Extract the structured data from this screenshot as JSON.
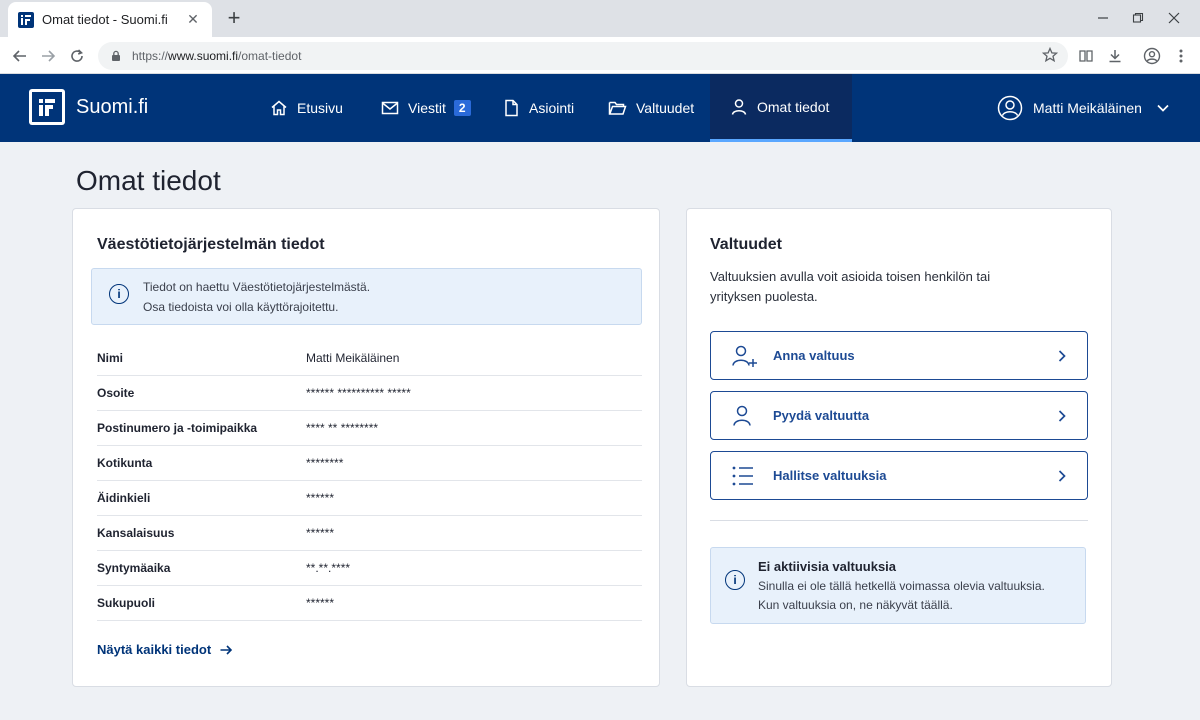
{
  "browser": {
    "tab_title": "Omat tiedot - Suomi.fi",
    "tab_close": "✕",
    "new_tab": "+",
    "url_prefix": "https://",
    "url_host": "www.suomi.fi",
    "url_path": "/omat-tiedot"
  },
  "site": {
    "brand": "Suomi.fi",
    "nav": [
      {
        "label": "Etusivu",
        "icon": "home-icon"
      },
      {
        "label": "Viestit",
        "icon": "mail-icon",
        "badge": "2"
      },
      {
        "label": "Asiointi",
        "icon": "document-icon"
      },
      {
        "label": "Valtuudet",
        "icon": "folder-icon"
      },
      {
        "label": "Omat tiedot",
        "icon": "person-icon",
        "active": true
      }
    ],
    "user_name": "Matti Meikäläinen"
  },
  "page": {
    "title": "Omat tiedot"
  },
  "population_info": {
    "title": "Väestötietojärjestelmän tiedot",
    "info_line1": "Tiedot on haettu Väestötietojärjestelmästä.",
    "info_line2": "Osa tiedoista voi olla käyttörajoitettu.",
    "rows": [
      {
        "label": "Nimi",
        "value": "Matti Meikäläinen"
      },
      {
        "label": "Osoite",
        "value": "****** ********** *****"
      },
      {
        "label": "Postinumero ja -toimipaikka",
        "value": "**** ** ********"
      },
      {
        "label": "Kotikunta",
        "value": "********"
      },
      {
        "label": "Äidinkieli",
        "value": "******"
      },
      {
        "label": "Kansalaisuus",
        "value": "******"
      },
      {
        "label": "Syntymäaika",
        "value": "**.**.****"
      },
      {
        "label": "Sukupuoli",
        "value": "******"
      }
    ],
    "show_all": "Näytä kaikki tiedot"
  },
  "mandates": {
    "title": "Valtuudet",
    "description": "Valtuuksien avulla voit asioida toisen henkilön tai yrityksen puolesta.",
    "actions": [
      {
        "label": "Anna valtuus",
        "icon": "add-person-icon"
      },
      {
        "label": "Pyydä valtuutta",
        "icon": "person-icon"
      },
      {
        "label": "Hallitse valtuuksia",
        "icon": "list-icon"
      }
    ],
    "notice_title": "Ei aktiivisia valtuuksia",
    "notice_line1": "Sinulla ei ole tällä hetkellä voimassa olevia valtuuksia.",
    "notice_line2": "Kun valtuuksia on, ne näkyvät täällä."
  },
  "colors": {
    "brand_blue": "#003479",
    "accent": "#1d4a94",
    "info_bg": "#e8f1fb"
  }
}
